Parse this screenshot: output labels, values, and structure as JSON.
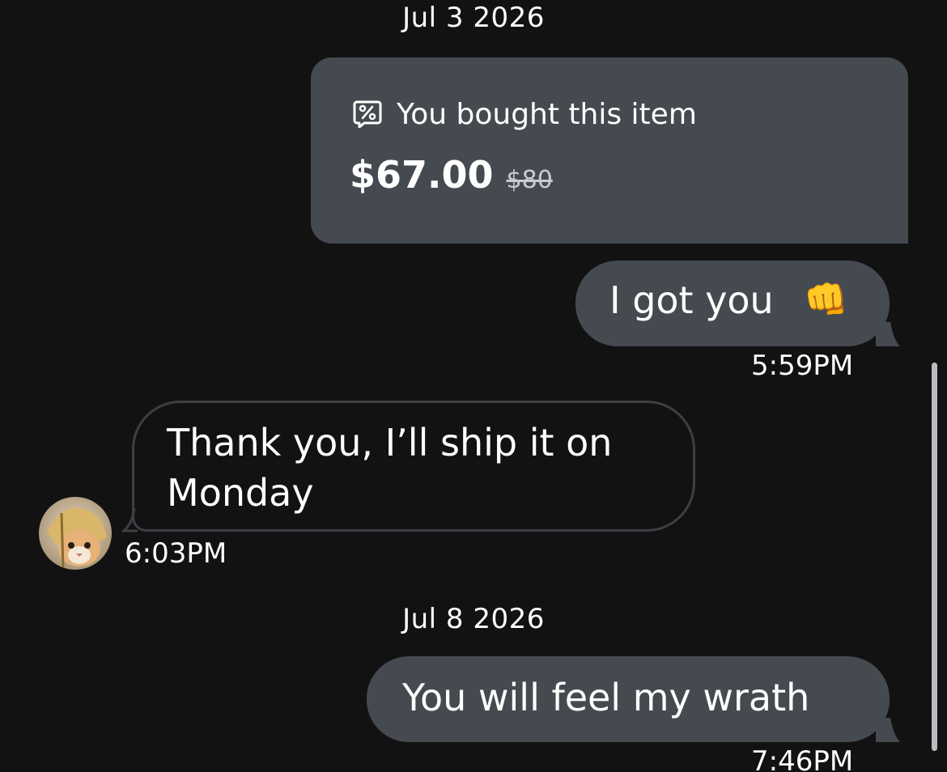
{
  "conversation": {
    "date_separators": [
      "Jul 3 2026",
      "Jul 8 2026"
    ],
    "purchase": {
      "icon": "discount-tag-icon",
      "label": "You bought this item",
      "price": "$67.00",
      "original_price": "$80"
    },
    "messages": [
      {
        "direction": "outgoing",
        "text": "I got you",
        "emoji": "👊",
        "time": "5:59PM"
      },
      {
        "direction": "incoming",
        "text": "Thank you, I’ll ship it on Monday",
        "time": "6:03PM",
        "avatar": "cat-avatar"
      },
      {
        "direction": "outgoing",
        "text": "You will feel my wrath",
        "time": "7:46PM"
      }
    ]
  },
  "colors": {
    "background": "#121213",
    "outgoing_bubble": "#454a50",
    "incoming_border": "#3c3f44",
    "text": "#ffffff"
  }
}
